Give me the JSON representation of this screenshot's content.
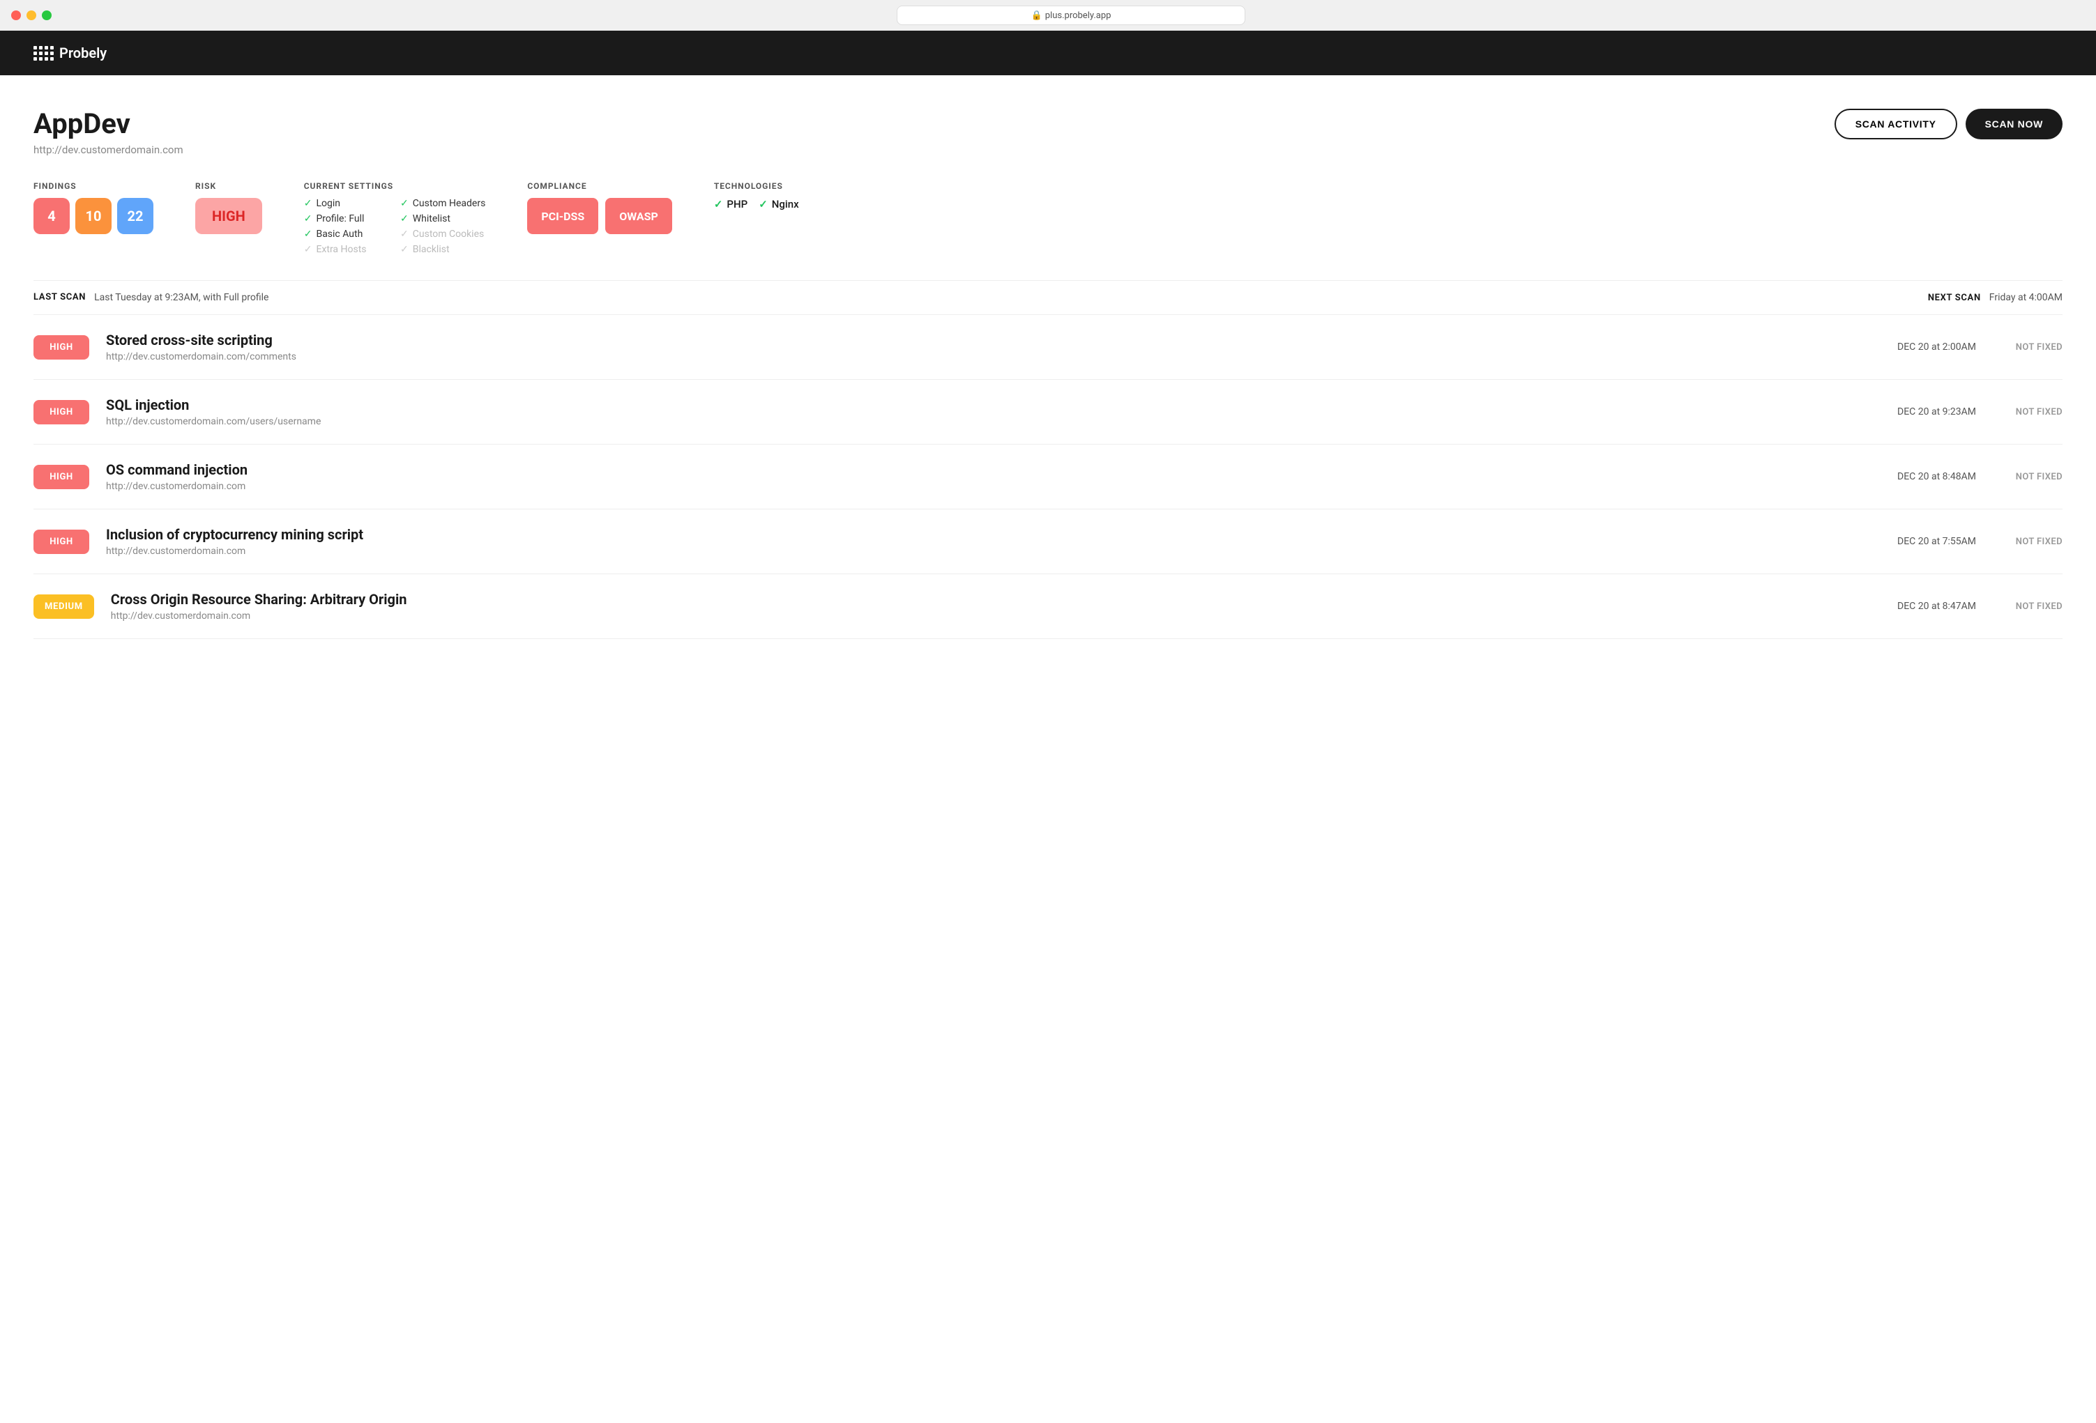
{
  "titleBar": {
    "url": "plus.probely.app"
  },
  "nav": {
    "logo_text": "Probely"
  },
  "app": {
    "title": "AppDev",
    "url": "http://dev.customerdomain.com"
  },
  "actions": {
    "scan_activity_label": "SCAN ACTIVITY",
    "scan_now_label": "SCAN NOW"
  },
  "findings": {
    "label": "FINDINGS",
    "counts": [
      {
        "value": "4",
        "color": "red"
      },
      {
        "value": "10",
        "color": "orange"
      },
      {
        "value": "22",
        "color": "blue"
      }
    ]
  },
  "risk": {
    "label": "RISK",
    "value": "HIGH"
  },
  "currentSettings": {
    "label": "CURRENT SETTINGS",
    "items": [
      {
        "name": "Login",
        "active": true
      },
      {
        "name": "Custom Headers",
        "active": true
      },
      {
        "name": "Profile: Full",
        "active": true
      },
      {
        "name": "Whitelist",
        "active": true
      },
      {
        "name": "Basic Auth",
        "active": true
      },
      {
        "name": "Custom Cookies",
        "active": false
      },
      {
        "name": "Extra Hosts",
        "active": false
      },
      {
        "name": "Blacklist",
        "active": false
      }
    ]
  },
  "compliance": {
    "label": "COMPLIANCE",
    "badges": [
      {
        "name": "PCI-DSS"
      },
      {
        "name": "OWASP"
      }
    ]
  },
  "technologies": {
    "label": "TECHNOLOGIES",
    "items": [
      {
        "name": "PHP"
      },
      {
        "name": "Nginx"
      }
    ]
  },
  "lastScan": {
    "label": "LAST SCAN",
    "value": "Last Tuesday at 9:23AM, with Full profile"
  },
  "nextScan": {
    "label": "NEXT SCAN",
    "value": "Friday at 4:00AM"
  },
  "findingsList": [
    {
      "severity": "HIGH",
      "title": "Stored cross-site scripting",
      "url": "http://dev.customerdomain.com/comments",
      "date": "DEC 20 at 2:00AM",
      "status": "NOT FIXED"
    },
    {
      "severity": "HIGH",
      "title": "SQL injection",
      "url": "http://dev.customerdomain.com/users/username",
      "date": "DEC 20 at 9:23AM",
      "status": "NOT FIXED"
    },
    {
      "severity": "HIGH",
      "title": "OS command injection",
      "url": "http://dev.customerdomain.com",
      "date": "DEC 20 at 8:48AM",
      "status": "NOT FIXED"
    },
    {
      "severity": "HIGH",
      "title": "Inclusion of cryptocurrency mining script",
      "url": "http://dev.customerdomain.com",
      "date": "DEC 20 at 7:55AM",
      "status": "NOT FIXED"
    },
    {
      "severity": "MEDIUM",
      "title": "Cross Origin Resource Sharing: Arbitrary Origin",
      "url": "http://dev.customerdomain.com",
      "date": "DEC 20 at 8:47AM",
      "status": "NOT FIXED"
    }
  ]
}
